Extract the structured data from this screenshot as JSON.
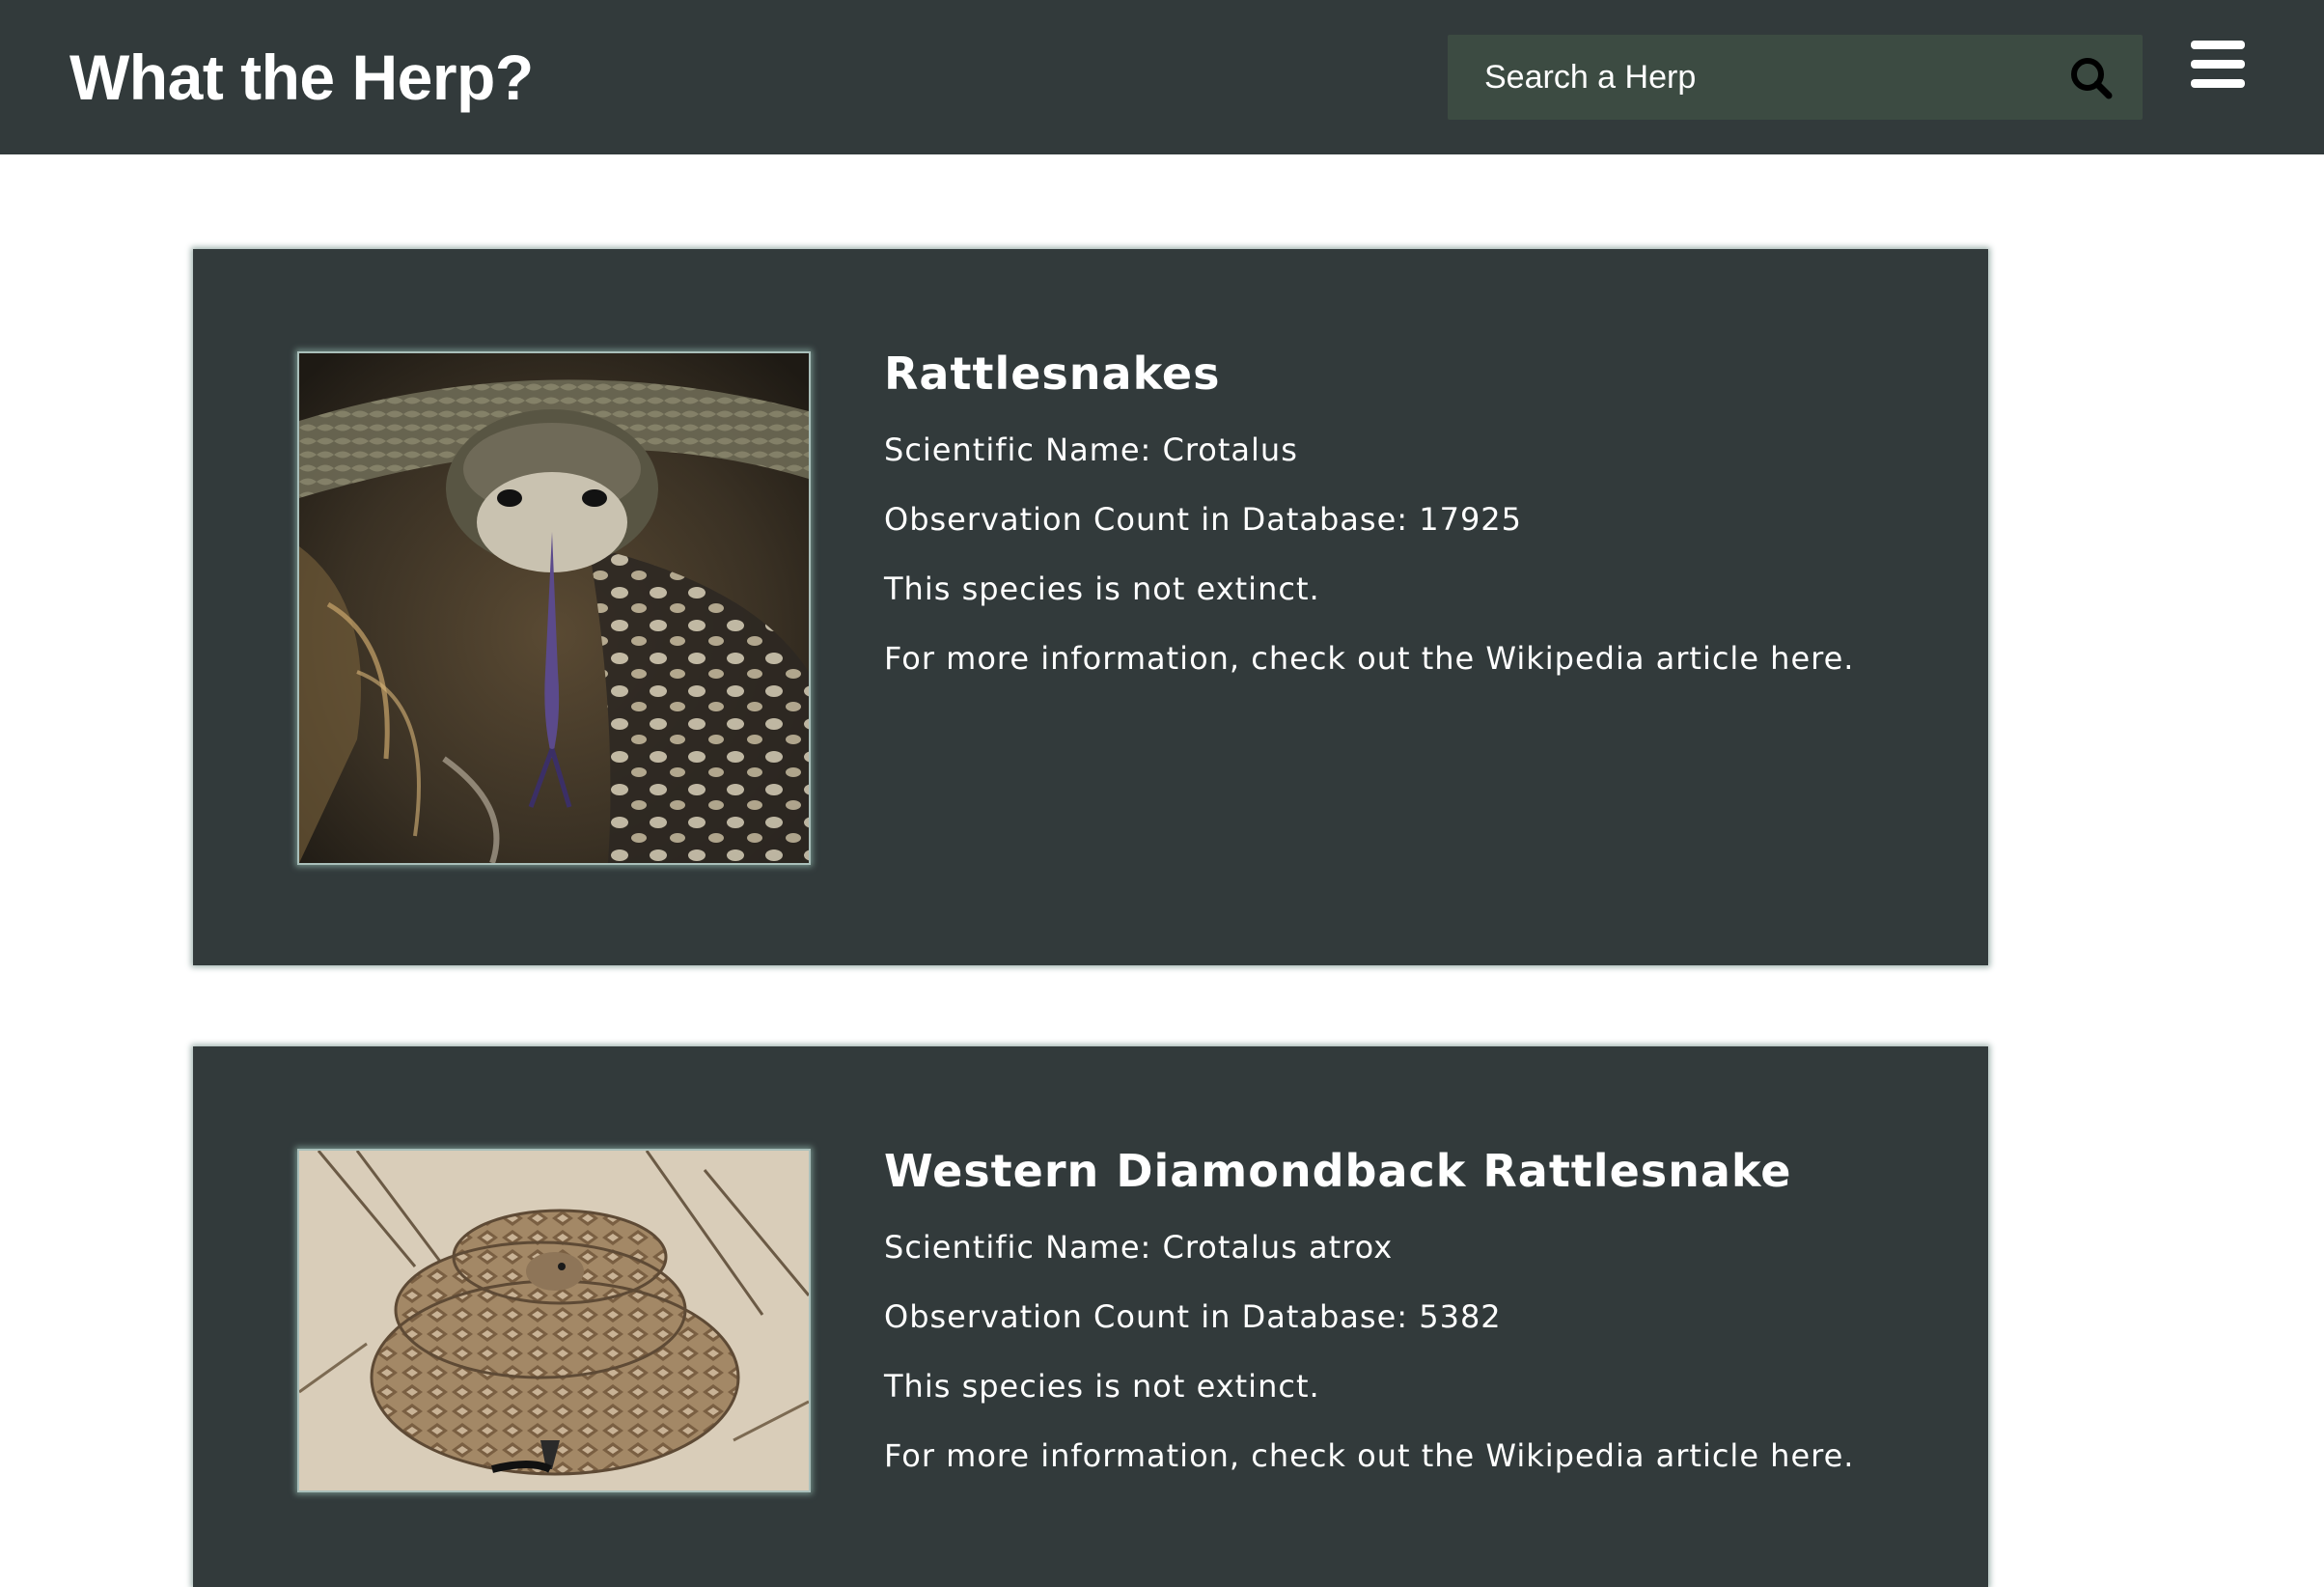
{
  "header": {
    "title": "What the Herp?",
    "search_placeholder": "Search a Herp",
    "search_icon": "search-icon",
    "menu_icon": "hamburger-menu-icon"
  },
  "colors": {
    "header_bg": "#323a3b",
    "card_bg": "#323a3b",
    "search_bg": "#3c4b42",
    "text": "#ffffff"
  },
  "species": [
    {
      "name": "Rattlesnakes",
      "scientific": "Scientific Name: Crotalus",
      "observations": "Observation Count in Database: 17925",
      "status": "This species is not extinct.",
      "more": "For more information, check out the Wikipedia article here."
    },
    {
      "name": "Western Diamondback Rattlesnake",
      "scientific": "Scientific Name: Crotalus atrox",
      "observations": "Observation Count in Database: 5382",
      "status": "This species is not extinct.",
      "more": "For more information, check out the Wikipedia article here."
    }
  ]
}
